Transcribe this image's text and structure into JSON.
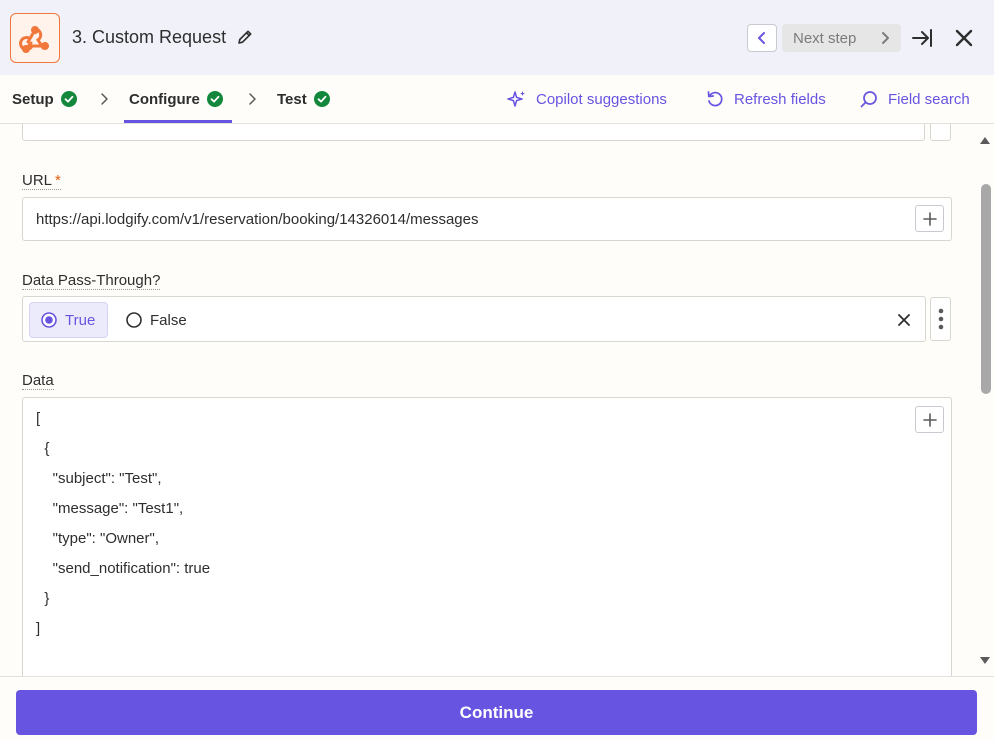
{
  "header": {
    "step_title": "3. Custom Request",
    "next_step_label": "Next step"
  },
  "tabs": [
    {
      "label": "Setup"
    },
    {
      "label": "Configure"
    },
    {
      "label": "Test"
    }
  ],
  "tools": {
    "copilot": "Copilot suggestions",
    "refresh": "Refresh fields",
    "search": "Field search"
  },
  "form": {
    "url_label": "URL",
    "url_required_mark": "*",
    "url_value": "https://api.lodgify.com/v1/reservation/booking/14326014/messages",
    "pass_through_label": "Data Pass-Through?",
    "pass_through_options": {
      "true_label": "True",
      "false_label": "False"
    },
    "pass_through_selected": "True",
    "data_label": "Data",
    "data_lines": [
      "[",
      "  {",
      "    \"subject\": \"Test\",",
      "    \"message\": \"Test1\",",
      "    \"type\": \"Owner\",",
      "    \"send_notification\": true",
      "  }",
      "]"
    ]
  },
  "footer": {
    "continue_label": "Continue"
  },
  "colors": {
    "accent": "#6754e0",
    "brand_orange": "#f2773a",
    "success_green": "#13883c",
    "required": "#e8590c"
  }
}
